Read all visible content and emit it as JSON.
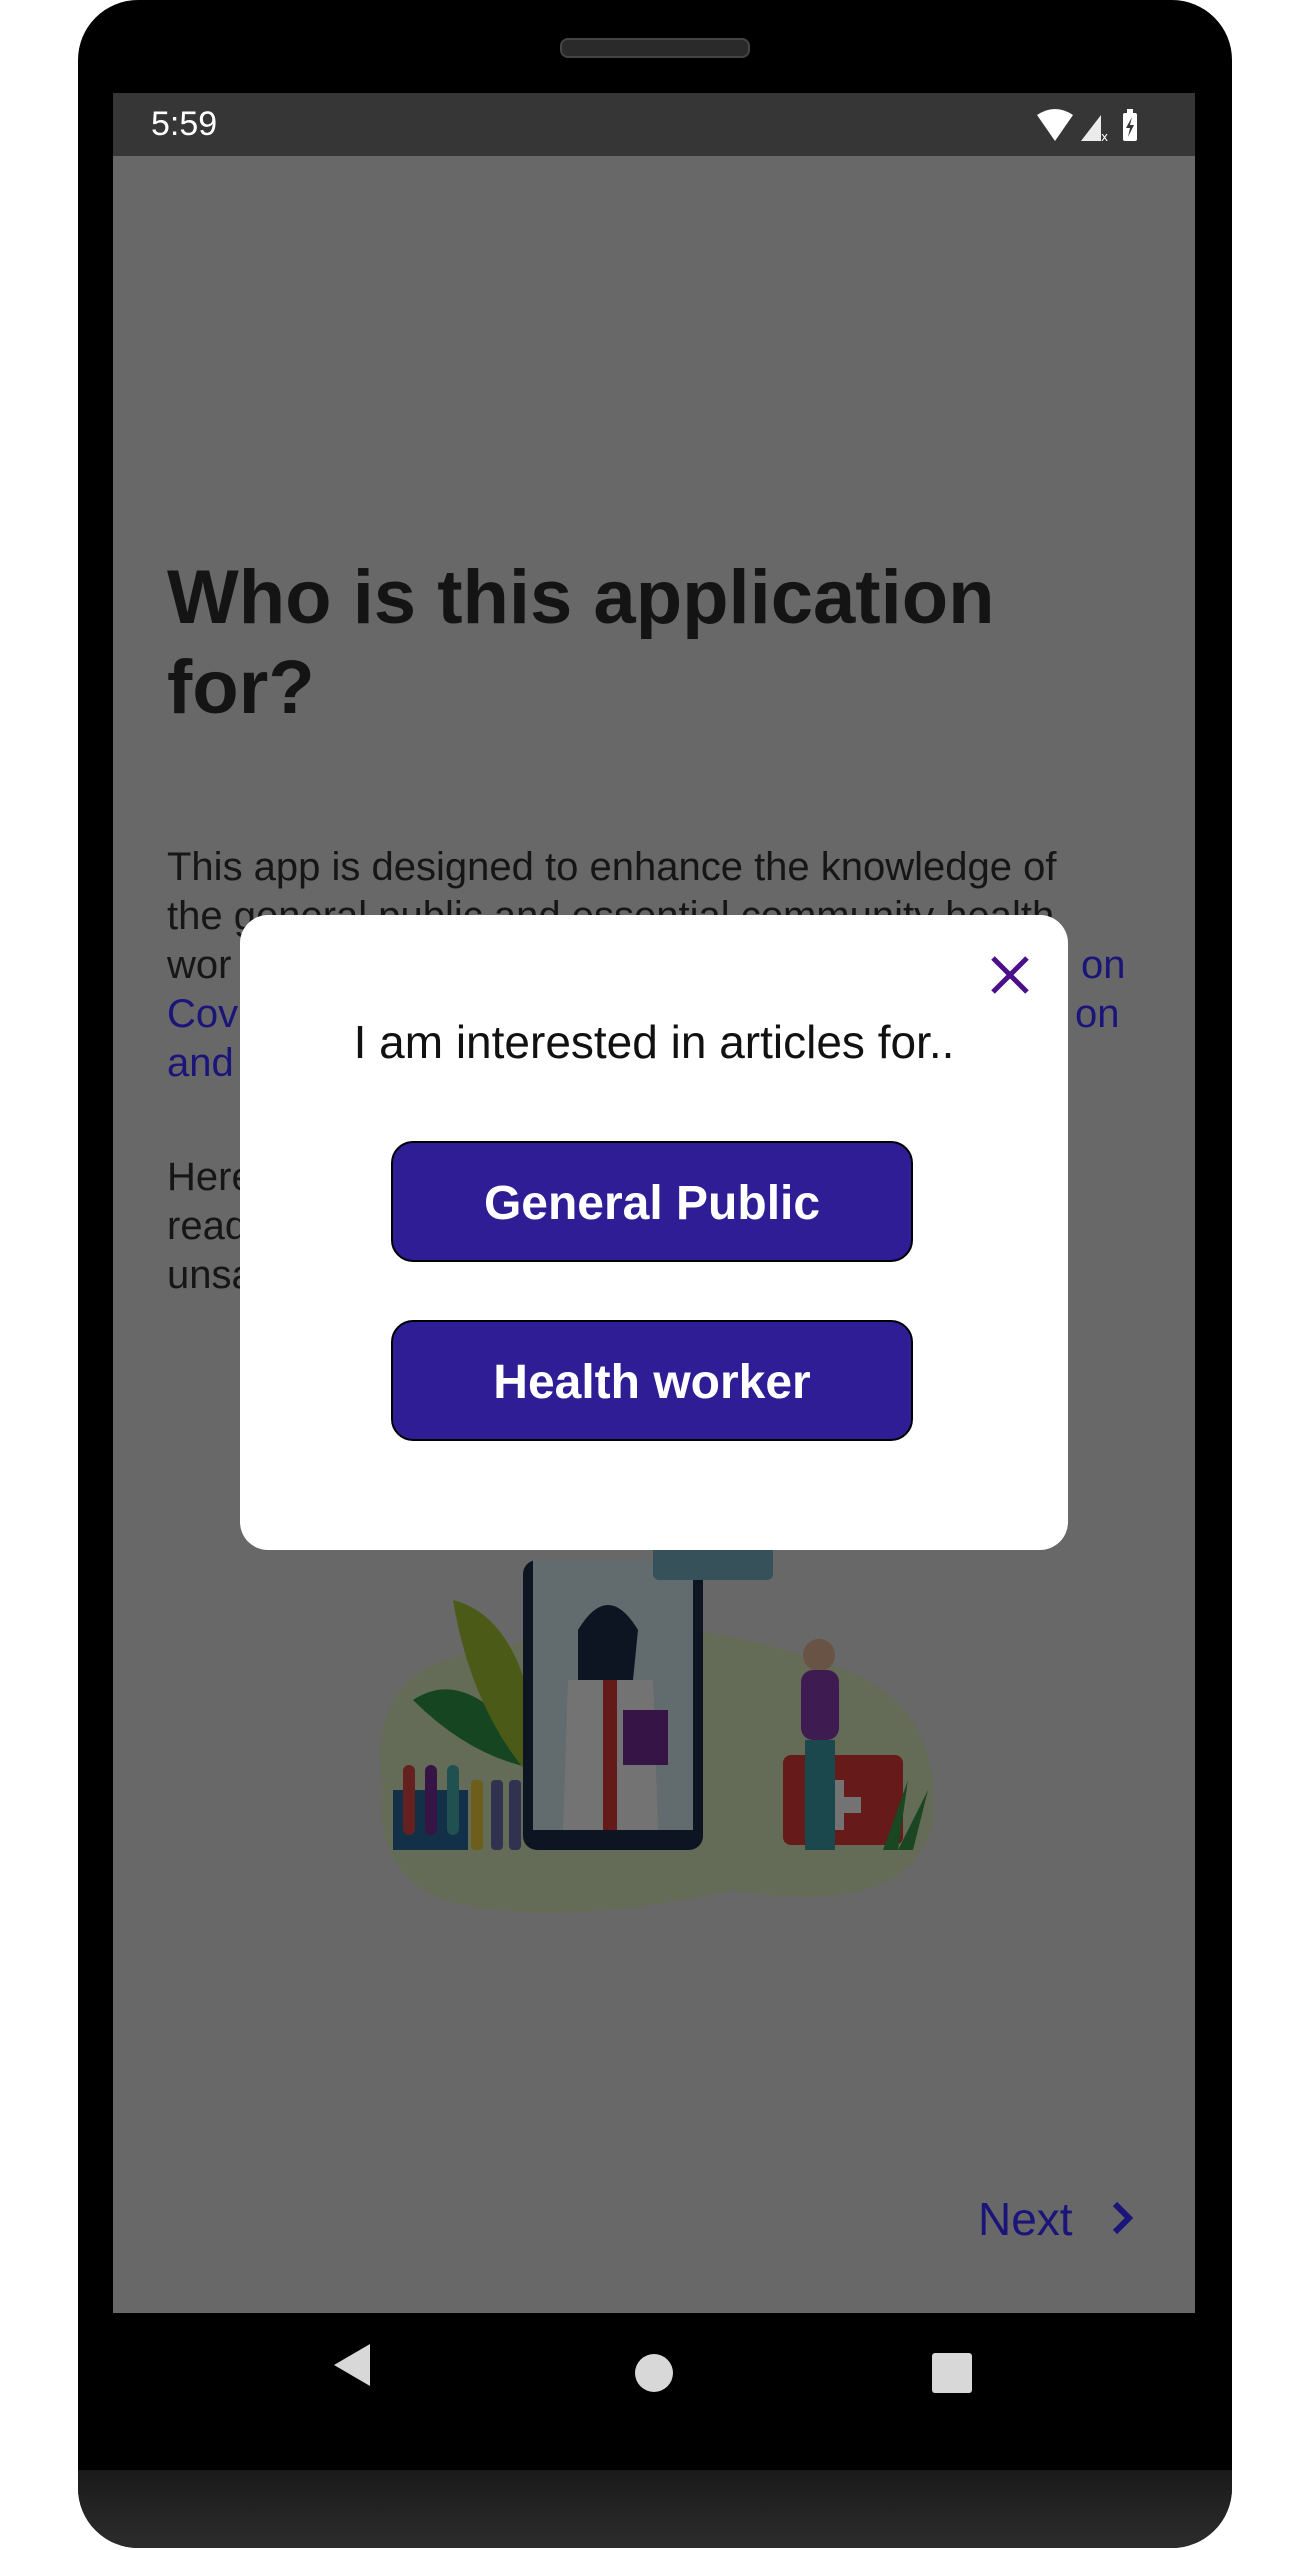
{
  "status_bar": {
    "time": "5:59",
    "icons": [
      "wifi-icon",
      "signal-no-data-icon",
      "battery-charging-icon"
    ]
  },
  "page": {
    "title": "Who is this application for?",
    "paragraph1_lines": [
      {
        "left": "This app is designed to enhance the knowledge of"
      },
      {
        "left": "the general public and essential community health"
      },
      {
        "left": "wor",
        "right": "on"
      },
      {
        "left": "Cov",
        "right": "on"
      },
      {
        "left": "and"
      }
    ],
    "paragraph2_lines": [
      {
        "left": "Here"
      },
      {
        "left": "read"
      },
      {
        "left": "unsa"
      }
    ],
    "next_label": "Next"
  },
  "modal": {
    "title": "I am interested in articles for..",
    "options": [
      "General Public",
      "Health worker"
    ],
    "close_icon": "close-icon"
  },
  "colors": {
    "accent": "#2e1d94",
    "link": "#1a14b0",
    "close": "#4b0f8a"
  },
  "nav_bar": {
    "icons": [
      "back-icon",
      "home-icon",
      "recents-icon"
    ]
  }
}
